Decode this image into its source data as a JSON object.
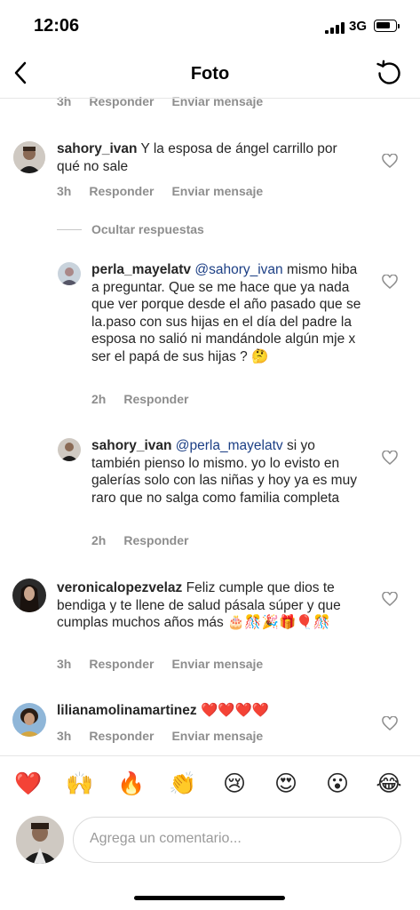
{
  "status_bar": {
    "time": "12:06",
    "network": "3G"
  },
  "header": {
    "title": "Foto"
  },
  "top_partial": {
    "time": "3h",
    "reply": "Responder",
    "send": "Enviar mensaje"
  },
  "comments": [
    {
      "username": "sahory_ivan",
      "text": "Y la esposa de ángel carrillo por qué no sale",
      "time": "3h",
      "reply": "Responder",
      "send": "Enviar mensaje"
    },
    {
      "username": "veronicalopezvelaz",
      "text": "Feliz cumple que dios te bendiga y te llene de salud pásala súper y que cumplas muchos años más 🎂🎊🎉🎁🎈🎊",
      "time": "3h",
      "reply": "Responder",
      "send": "Enviar mensaje"
    },
    {
      "username": "lilianamolinamartinez",
      "text": "❤️❤️❤️❤️",
      "time": "3h",
      "reply": "Responder",
      "send": "Enviar mensaje"
    }
  ],
  "hide_replies": "Ocultar respuestas",
  "replies": [
    {
      "username": "perla_mayelatv",
      "mention": "@sahory_ivan",
      "text": "mismo hiba a preguntar.  Que se me hace que ya nada que ver porque desde el año pasado que se la.paso con sus hijas en el día del padre la esposa no salió ni mandándole algún mje x ser el papá de sus hijas ? 🤔",
      "time": "2h",
      "reply": "Responder"
    },
    {
      "username": "sahory_ivan",
      "mention": "@perla_mayelatv",
      "text": "si yo también pienso lo mismo. yo lo evisto en galerías solo con las niñas y hoy ya es muy raro que no salga como familia completa",
      "time": "2h",
      "reply": "Responder"
    }
  ],
  "emoji_bar": [
    "❤️",
    "🙌",
    "🔥",
    "👏",
    "😢",
    "😍",
    "😮",
    "😂"
  ],
  "comment_input": {
    "placeholder": "Agrega un comentario..."
  },
  "colors": {
    "link": "#1c3f85",
    "secondary": "#8e8e8e",
    "text": "#262626"
  }
}
